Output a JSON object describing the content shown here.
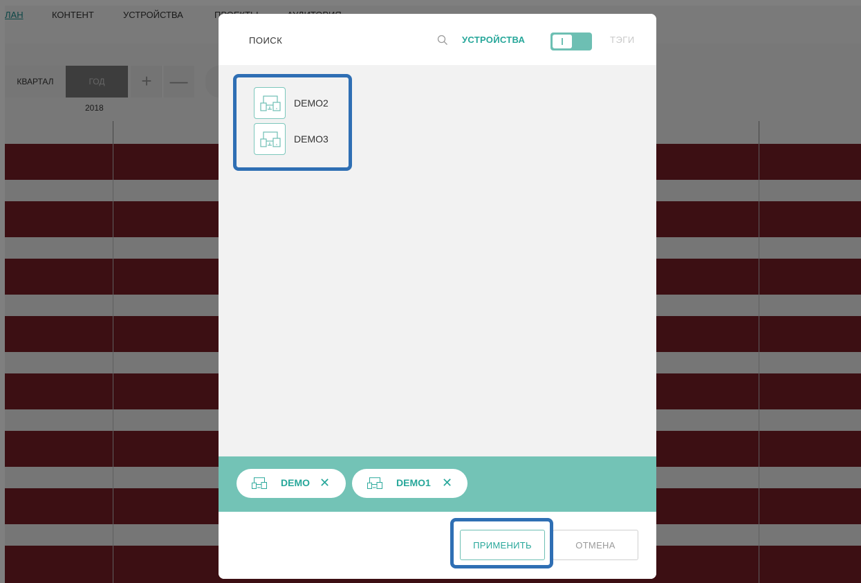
{
  "topnav": {
    "items": [
      "ЛАН",
      "КОНТЕНТ",
      "УСТРОЙСТВА",
      "ПРОЕКТЫ",
      "АУДИТОРИЯ"
    ]
  },
  "toolbar": {
    "quarter_label": "КВАРТАЛ",
    "year_label": "ГОД",
    "zoom_in": "+",
    "zoom_out": "—",
    "timeline_year": "2018"
  },
  "dialog": {
    "search_label": "ПОИСК",
    "tab_devices": "УСТРОЙСТВА",
    "tab_tags": "ТЭГИ",
    "search_results": [
      {
        "name": "DEMO2"
      },
      {
        "name": "DEMO3"
      }
    ],
    "selected": [
      {
        "name": "DEMO"
      },
      {
        "name": "DEMO1"
      }
    ],
    "apply_label": "ПРИМЕНИТЬ",
    "cancel_label": "ОТМЕНА"
  },
  "colors": {
    "accent": "#27a79a",
    "accent_light": "#73c3b6",
    "row_red": "#781f27",
    "highlight": "#2f6fb4"
  }
}
